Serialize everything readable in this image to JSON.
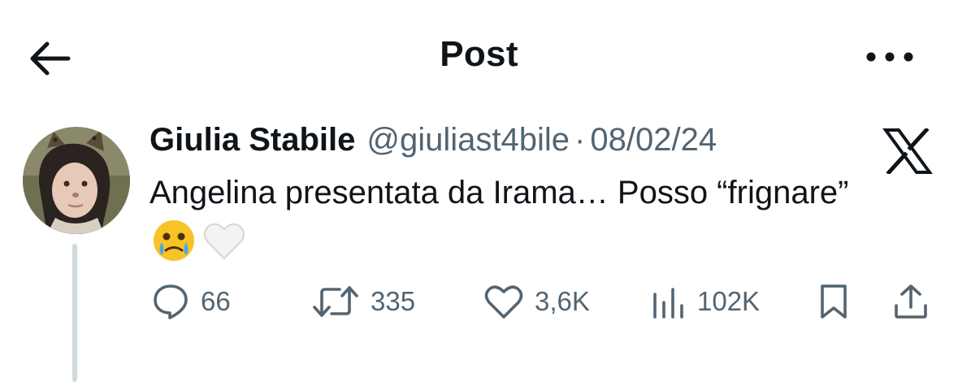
{
  "header": {
    "title": "Post",
    "back_icon": "arrow-left-icon",
    "more_icon": "more-horizontal-icon"
  },
  "tweet": {
    "author_name": "Giulia Stabile",
    "handle": "@giuliast4bile",
    "separator": "·",
    "date": "08/02/24",
    "text": "Angelina presentata da Irama… Posso “frignare”",
    "emojis": [
      "face-holding-back-tears-emoji",
      "white-heart-emoji"
    ],
    "source_logo": "x-logo-icon"
  },
  "actions": {
    "replies": "66",
    "reposts": "335",
    "likes": "3,6K",
    "views": "102K",
    "bookmark_icon": "bookmark-icon",
    "share_icon": "share-icon"
  },
  "colors": {
    "text_primary": "#0f1419",
    "text_secondary": "#536471",
    "thread_line": "#cfd9de",
    "background": "#ffffff"
  }
}
